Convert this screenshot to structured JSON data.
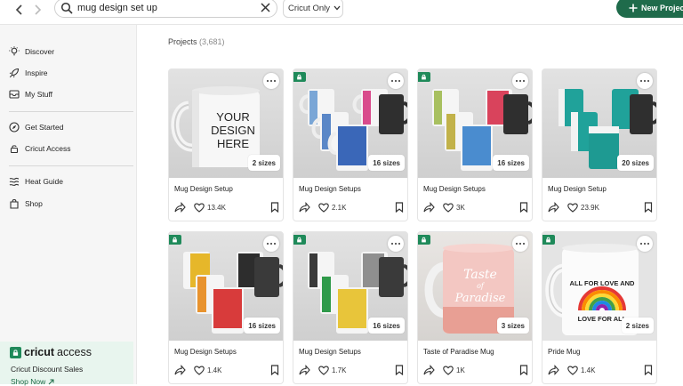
{
  "colors": {
    "brand_green": "#1f6b4b",
    "access_green": "#1f8a5a",
    "sidebar_bg": "#f6f6f6",
    "promo_bg": "#e8f5ee"
  },
  "topbar": {
    "back_icon": "chevron-left-icon",
    "forward_icon": "chevron-right-icon",
    "search_value": "mug design set up",
    "filter_label": "Cricut Only",
    "new_project_label": "New Project"
  },
  "sidebar": {
    "items": [
      {
        "label": "Discover",
        "icon": "lightbulb-icon"
      },
      {
        "label": "Inspire",
        "icon": "rocket-icon"
      },
      {
        "label": "My Stuff",
        "icon": "inbox-icon"
      },
      {
        "label": "Get Started",
        "icon": "compass-icon"
      },
      {
        "label": "Cricut Access",
        "icon": "lock-icon"
      },
      {
        "label": "Heat Guide",
        "icon": "heat-waves-icon"
      },
      {
        "label": "Shop",
        "icon": "shopping-bag-icon"
      }
    ],
    "promo": {
      "logo_a": "cricut",
      "logo_b": "access",
      "title": "Cricut Discount Sales",
      "link": "Shop Now"
    }
  },
  "main": {
    "heading": "Projects",
    "count": "(3,681)",
    "cards": [
      {
        "title": "Mug Design Setup",
        "sizes": "2 sizes",
        "likes": "13.4K",
        "access": false
      },
      {
        "title": "Mug Design Setups",
        "sizes": "16 sizes",
        "likes": "2.1K",
        "access": true
      },
      {
        "title": "Mug Design Setups",
        "sizes": "16 sizes",
        "likes": "3K",
        "access": true
      },
      {
        "title": "Mug Design Setup",
        "sizes": "20 sizes",
        "likes": "23.9K",
        "access": false
      },
      {
        "title": "Mug Design Setups",
        "sizes": "16 sizes",
        "likes": "1.4K",
        "access": true
      },
      {
        "title": "Mug Design Setups",
        "sizes": "16 sizes",
        "likes": "1.7K",
        "access": true
      },
      {
        "title": "Taste of Paradise Mug",
        "sizes": "3 sizes",
        "likes": "1K",
        "access": true
      },
      {
        "title": "Pride Mug",
        "sizes": "2 sizes",
        "likes": "1.4K",
        "access": true
      }
    ],
    "thumb_text": {
      "your_design_here": [
        "YOUR",
        "DESIGN",
        "HERE"
      ],
      "taste": [
        "Taste",
        "of",
        "Paradise"
      ],
      "pride_top": "ALL FOR LOVE AND",
      "pride_bottom": "LOVE FOR ALL"
    }
  }
}
